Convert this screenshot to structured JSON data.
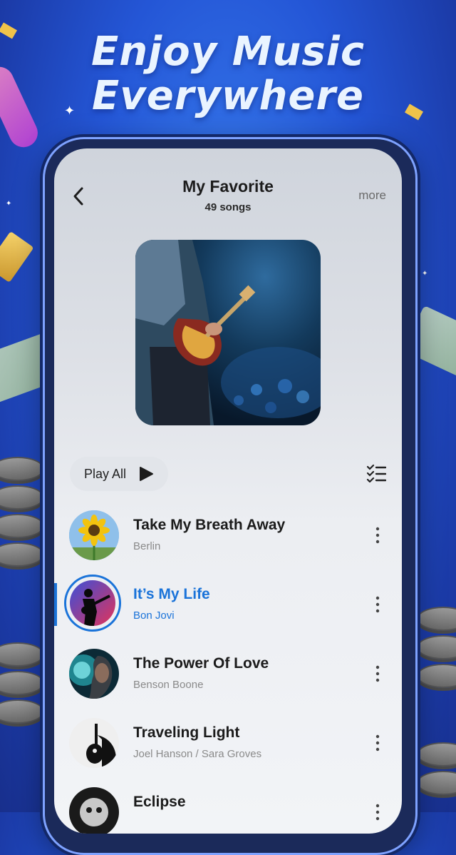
{
  "headline": {
    "line1": "Enjoy Music",
    "line2": "Everywhere"
  },
  "header": {
    "title": "My Favorite",
    "subtitle": "49 songs",
    "more_label": "more"
  },
  "actions": {
    "play_all_label": "Play All"
  },
  "songs": [
    {
      "title": "Take My Breath Away",
      "artist": "Berlin"
    },
    {
      "title": "It’s My Life",
      "artist": "Bon Jovi",
      "active": true
    },
    {
      "title": "The Power Of Love",
      "artist": "Benson Boone"
    },
    {
      "title": "Traveling Light",
      "artist": "Joel Hanson / Sara Groves"
    },
    {
      "title": "Eclipse",
      "artist": ""
    }
  ],
  "colors": {
    "accent": "#1a73d9",
    "background": "#2456d6"
  }
}
